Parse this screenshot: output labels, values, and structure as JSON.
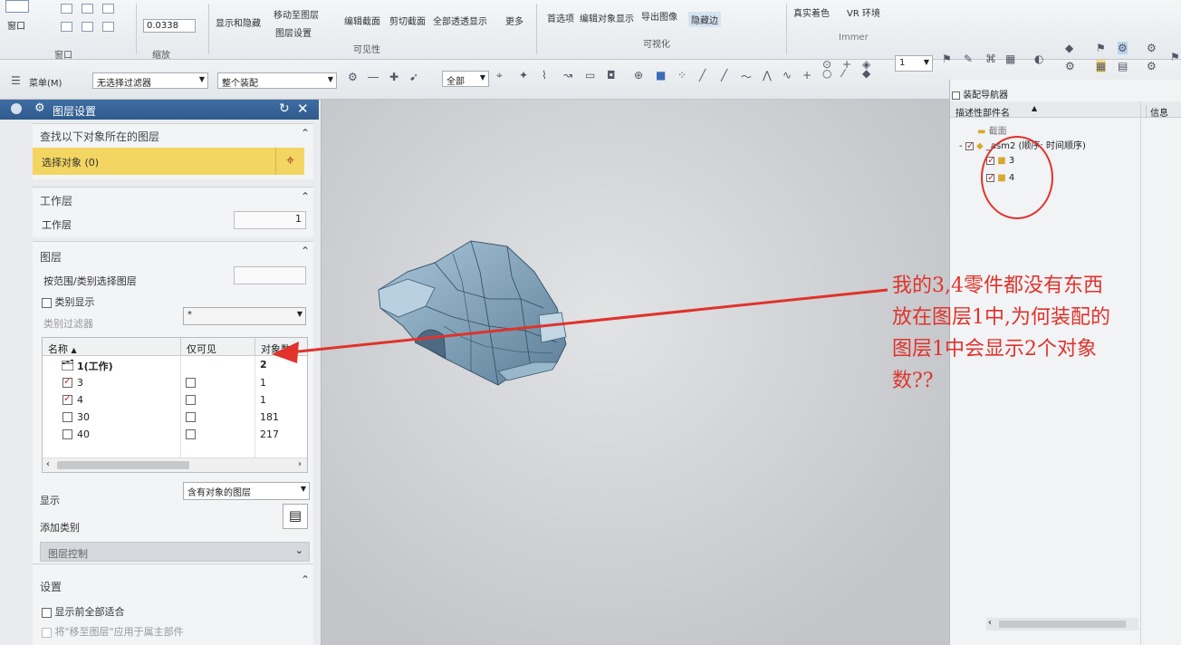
{
  "ribbon": {
    "window_label": "窗口",
    "group_window": "窗口",
    "zoom_value": "0.0338",
    "group_zoom": "缩放",
    "show_hide": "显示和隐藏",
    "move_to_layer": "移动至图层",
    "layer_settings": "图层设置",
    "edit_section": "编辑截面",
    "clip_section": "剪切截面",
    "show_all_through": "全部透透显示",
    "more": "更多",
    "group_visibility": "可见性",
    "preferences": "首选项",
    "edit_obj_display": "编辑对象显示",
    "export_drawing": "导出图像",
    "silhouette": "隐藏边",
    "group_visualize": "可视化",
    "true_shading": "真实着色",
    "vr_env": "VR 环境",
    "immer": "Immer"
  },
  "toolbar": {
    "menu": "菜单(M)",
    "filter": "无选择过滤器",
    "assembly_scope": "整个装配",
    "all": "全部",
    "count": "1"
  },
  "panel": {
    "title": "图层设置",
    "find_header": "查找以下对象所在的图层",
    "select_object": "选择对象 (0)",
    "work_layer_header": "工作层",
    "work_layer_label": "工作层",
    "work_layer_value": "1",
    "layers_header": "图层",
    "select_by_range": "按范围/类别选择图层",
    "category_display": "类别显示",
    "category_filter": "类别过滤器",
    "category_filter_value": "*",
    "col_name": "名称",
    "col_visible_only": "仅可见",
    "col_count": "对象数",
    "rows": [
      {
        "name": "1(工作)",
        "count": "2",
        "checked": false,
        "work": true
      },
      {
        "name": "3",
        "count": "1",
        "checked": true,
        "work": false
      },
      {
        "name": "4",
        "count": "1",
        "checked": true,
        "work": false
      },
      {
        "name": "30",
        "count": "181",
        "checked": false,
        "work": false
      },
      {
        "name": "40",
        "count": "217",
        "checked": false,
        "work": false
      }
    ],
    "display_label": "显示",
    "display_value": "含有对象的图层",
    "add_category": "添加类别",
    "layer_control": "图层控制",
    "settings_header": "设置",
    "fit_all_before_display": "显示前全部适合",
    "apply_to_owner": "将\"移至图层\"应用于属主部件"
  },
  "navigator": {
    "title": "装配导航器",
    "col_desc": "描述性部件名",
    "col_info": "信息",
    "section": "截面",
    "root": "_asm2 (顺序: 时间顺序)",
    "children": [
      "3",
      "4"
    ]
  },
  "annotation": {
    "line1": "我的3,4零件都没有东西",
    "line2": "放在图层1中,为何装配的",
    "line3": "图层1中会显示2个对象",
    "line4": "数??"
  },
  "colors": {
    "annotation": "#e0332c",
    "panel_title": "#2f5a8c",
    "highlight": "#f3d562",
    "model": "#8fb3cc"
  }
}
